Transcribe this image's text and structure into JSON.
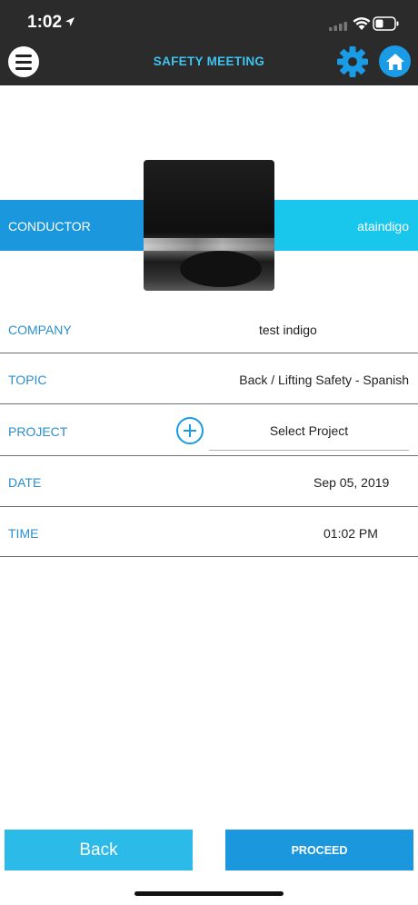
{
  "status_bar": {
    "time": "1:02"
  },
  "nav": {
    "title": "SAFETY MEETING",
    "menu_icon": "hamburger-menu-icon",
    "settings_icon": "gear-icon",
    "home_icon": "home-icon"
  },
  "conductor": {
    "label": "CONDUCTOR",
    "value": "ataindigo"
  },
  "form": {
    "company": {
      "label": "COMPANY",
      "value": "test indigo"
    },
    "topic": {
      "label": "TOPIC",
      "value": "Back / Lifting Safety - Spanish"
    },
    "project": {
      "label": "PROJECT",
      "placeholder": "Select Project"
    },
    "date": {
      "label": "DATE",
      "value": "Sep 05, 2019"
    },
    "time": {
      "label": "TIME",
      "value": "01:02 PM"
    }
  },
  "actions": {
    "back_label": "Back",
    "proceed_label": "PROCEED"
  },
  "colors": {
    "header_bg": "#2b2b2b",
    "accent_blue": "#1b97dd",
    "accent_cyan": "#19c6ec",
    "label_blue": "#2b8fcc",
    "title_cyan": "#3ec3f0"
  }
}
